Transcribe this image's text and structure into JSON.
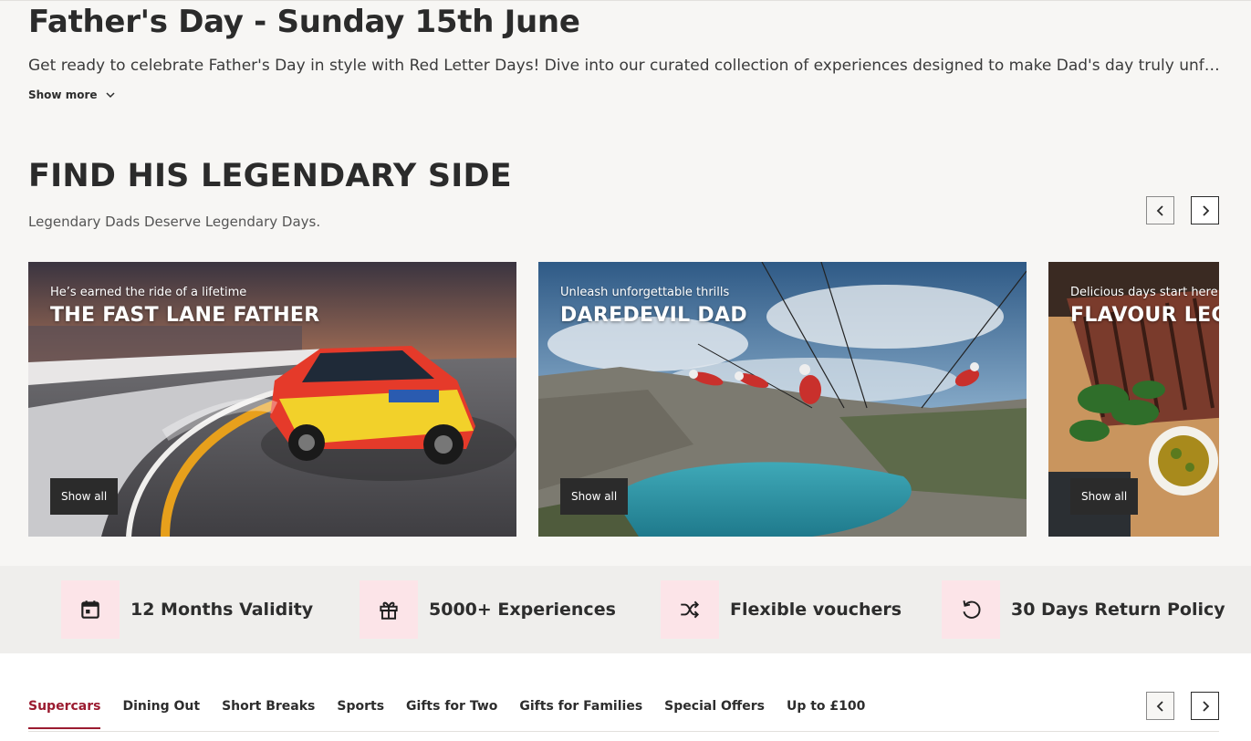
{
  "hero": {
    "title": "Father's Day - Sunday 15th June",
    "description": "Get ready to celebrate Father's Day in style with Red Letter Days! Dive into our curated collection of experiences designed to make Dad's day truly unforgettable...",
    "show_more": "Show more"
  },
  "section": {
    "title": "FIND HIS LEGENDARY SIDE",
    "subtitle": "Legendary Dads Deserve Legendary Days.",
    "cards": [
      {
        "eyebrow": "He’s earned the ride of a lifetime",
        "title": "THE FAST LANE FATHER",
        "button": "Show all",
        "image": "race-car-on-track"
      },
      {
        "eyebrow": "Unleash unforgettable thrills",
        "title": "DAREDEVIL DAD",
        "button": "Show all",
        "image": "zipline-over-quarry-lake"
      },
      {
        "eyebrow": "Delicious days start here",
        "title": "FLAVOUR LEGEND",
        "button": "Show all",
        "image": "steak-on-board"
      }
    ]
  },
  "usps": [
    {
      "icon": "calendar-icon",
      "label": "12 Months Validity"
    },
    {
      "icon": "gift-icon",
      "label": "5000+ Experiences"
    },
    {
      "icon": "shuffle-icon",
      "label": "Flexible vouchers"
    },
    {
      "icon": "return-icon",
      "label": "30 Days Return Policy"
    }
  ],
  "tabs": {
    "items": [
      "Supercars",
      "Dining Out",
      "Short Breaks",
      "Sports",
      "Gifts for Two",
      "Gifts for Families",
      "Special Offers",
      "Up to £100"
    ],
    "active": "Supercars"
  },
  "colors": {
    "accent": "#9b1b30",
    "dark": "#2b2b2b",
    "usp_icon_bg": "#fce4e8",
    "page_bg": "#f7f6f4"
  }
}
